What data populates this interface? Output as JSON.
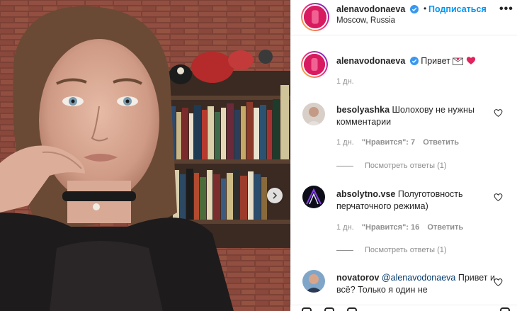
{
  "header": {
    "username": "alenavodonaeva",
    "separator": "•",
    "follow_label": "Подписаться",
    "location": "Moscow, Russia",
    "more": "•••"
  },
  "caption": {
    "username": "alenavodonaeva",
    "text": "Привет",
    "emoji": [
      "envelope-heart-emoji",
      "red-heart-emoji"
    ],
    "time": "1 дн."
  },
  "comments": [
    {
      "username": "besolyashka",
      "text": "Шолохову не нужны комментарии",
      "time": "1 дн.",
      "likes": "\"Нравится\": 7",
      "reply_label": "Ответить",
      "view_replies": "Посмотреть ответы (1)"
    },
    {
      "username": "absolytno.vse",
      "text": "Полуготовность перчаточного режима)",
      "time": "1 дн.",
      "likes": "\"Нравится\": 16",
      "reply_label": "Ответить",
      "view_replies": "Посмотреть ответы (1)"
    },
    {
      "username": "novatorov",
      "mention": "@alenavodonaeva",
      "text": "Привет и всё? Только я один не"
    }
  ],
  "colors": {
    "accent": "#0095f6",
    "muted": "#8e8e8e",
    "text": "#262626",
    "heart": "#ed4956"
  }
}
